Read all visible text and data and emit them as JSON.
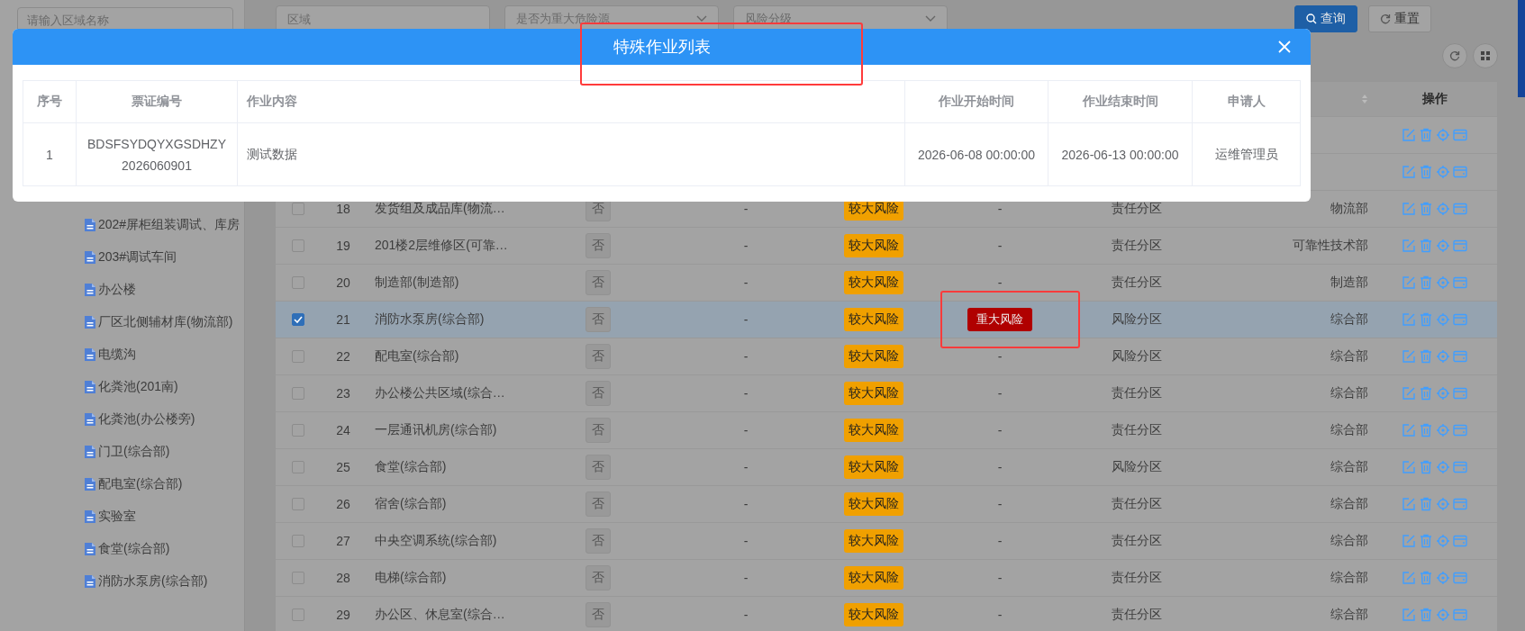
{
  "sidebar": {
    "search": {
      "placeholder": "请输入区域名称"
    },
    "tree_items": [
      {
        "label": "202#屏柜组装调试、库房"
      },
      {
        "label": "203#调试车间"
      },
      {
        "label": "办公楼"
      },
      {
        "label": "厂区北侧辅材库(物流部)"
      },
      {
        "label": "电缆沟"
      },
      {
        "label": "化粪池(201南)"
      },
      {
        "label": "化粪池(办公楼旁)"
      },
      {
        "label": "门卫(综合部)"
      },
      {
        "label": "配电室(综合部)"
      },
      {
        "label": "实验室"
      },
      {
        "label": "食堂(综合部)"
      },
      {
        "label": "消防水泵房(综合部)"
      }
    ]
  },
  "filters": [
    {
      "kind": "input",
      "placeholder": "区域"
    },
    {
      "kind": "select",
      "placeholder": "是否为重大危险源"
    },
    {
      "kind": "select",
      "placeholder": "风险分级"
    }
  ],
  "buttons": [
    {
      "label": "查询",
      "kind": "primary"
    },
    {
      "label": "重置",
      "kind": "default"
    }
  ],
  "table": {
    "action_column_label": "操作",
    "rows": [
      {
        "kind": "covered"
      },
      {
        "kind": "covered"
      },
      {
        "kind": "full",
        "selected": false,
        "index": "18",
        "name": "发货组及成品库(物流…",
        "major_hazard": "否",
        "column_5": "-",
        "risk_level": {
          "label": "较大风险",
          "color": "#f0a000"
        },
        "column_7": {
          "kind": "text",
          "text": "-"
        },
        "zone": "责任分区",
        "department": "物流部"
      },
      {
        "kind": "full",
        "selected": false,
        "index": "19",
        "name": "201楼2层维修区(可靠…",
        "major_hazard": "否",
        "column_5": "-",
        "risk_level": {
          "label": "较大风险",
          "color": "#f0a000"
        },
        "column_7": {
          "kind": "text",
          "text": "-"
        },
        "zone": "责任分区",
        "department": "可靠性技术部"
      },
      {
        "kind": "full",
        "selected": false,
        "index": "20",
        "name": "制造部(制造部)",
        "major_hazard": "否",
        "column_5": "-",
        "risk_level": {
          "label": "较大风险",
          "color": "#f0a000"
        },
        "column_7": {
          "kind": "text",
          "text": "-"
        },
        "zone": "责任分区",
        "department": "制造部"
      },
      {
        "kind": "full",
        "selected": true,
        "index": "21",
        "name": "消防水泵房(综合部)",
        "major_hazard": "否",
        "column_5": "-",
        "risk_level": {
          "label": "较大风险",
          "color": "#f0a000"
        },
        "column_7": {
          "kind": "badge",
          "text": "重大风险",
          "color": "#b00000",
          "highlighted": true
        },
        "zone": "风险分区",
        "department": "综合部"
      },
      {
        "kind": "full",
        "selected": false,
        "index": "22",
        "name": "配电室(综合部)",
        "major_hazard": "否",
        "column_5": "-",
        "risk_level": {
          "label": "较大风险",
          "color": "#f0a000"
        },
        "column_7": {
          "kind": "text",
          "text": "-"
        },
        "zone": "风险分区",
        "department": "综合部"
      },
      {
        "kind": "full",
        "selected": false,
        "index": "23",
        "name": "办公楼公共区域(综合…",
        "major_hazard": "否",
        "column_5": "-",
        "risk_level": {
          "label": "较大风险",
          "color": "#f0a000"
        },
        "column_7": {
          "kind": "text",
          "text": "-"
        },
        "zone": "责任分区",
        "department": "综合部"
      },
      {
        "kind": "full",
        "selected": false,
        "index": "24",
        "name": "一层通讯机房(综合部)",
        "major_hazard": "否",
        "column_5": "-",
        "risk_level": {
          "label": "较大风险",
          "color": "#f0a000"
        },
        "column_7": {
          "kind": "text",
          "text": "-"
        },
        "zone": "责任分区",
        "department": "综合部"
      },
      {
        "kind": "full",
        "selected": false,
        "index": "25",
        "name": "食堂(综合部)",
        "major_hazard": "否",
        "column_5": "-",
        "risk_level": {
          "label": "较大风险",
          "color": "#f0a000"
        },
        "column_7": {
          "kind": "text",
          "text": "-"
        },
        "zone": "风险分区",
        "department": "综合部"
      },
      {
        "kind": "full",
        "selected": false,
        "index": "26",
        "name": "宿舍(综合部)",
        "major_hazard": "否",
        "column_5": "-",
        "risk_level": {
          "label": "较大风险",
          "color": "#f0a000"
        },
        "column_7": {
          "kind": "text",
          "text": "-"
        },
        "zone": "责任分区",
        "department": "综合部"
      },
      {
        "kind": "full",
        "selected": false,
        "index": "27",
        "name": "中央空调系统(综合部)",
        "major_hazard": "否",
        "column_5": "-",
        "risk_level": {
          "label": "较大风险",
          "color": "#f0a000"
        },
        "column_7": {
          "kind": "text",
          "text": "-"
        },
        "zone": "责任分区",
        "department": "综合部"
      },
      {
        "kind": "full",
        "selected": false,
        "index": "28",
        "name": "电梯(综合部)",
        "major_hazard": "否",
        "column_5": "-",
        "risk_level": {
          "label": "较大风险",
          "color": "#f0a000"
        },
        "column_7": {
          "kind": "text",
          "text": "-"
        },
        "zone": "责任分区",
        "department": "综合部"
      },
      {
        "kind": "full",
        "selected": false,
        "index": "29",
        "name": "办公区、休息室(综合…",
        "major_hazard": "否",
        "column_5": "-",
        "risk_level": {
          "label": "较大风险",
          "color": "#f0a000"
        },
        "column_7": {
          "kind": "text",
          "text": "-"
        },
        "zone": "责任分区",
        "department": "综合部"
      }
    ]
  },
  "modal": {
    "title": "特殊作业列表",
    "title_highlighted": true,
    "columns": [
      "序号",
      "票证编号",
      "作业内容",
      "作业开始时间",
      "作业结束时间",
      "申请人"
    ],
    "rows": [
      {
        "index": "1",
        "ticket_no": [
          "BDSFSYDQYXGSDHZY",
          "2026060901"
        ],
        "content": "测试数据",
        "start_time": "2026-06-08 00:00:00",
        "end_time": "2026-06-13 00:00:00",
        "applicant": "运维管理员"
      }
    ]
  }
}
